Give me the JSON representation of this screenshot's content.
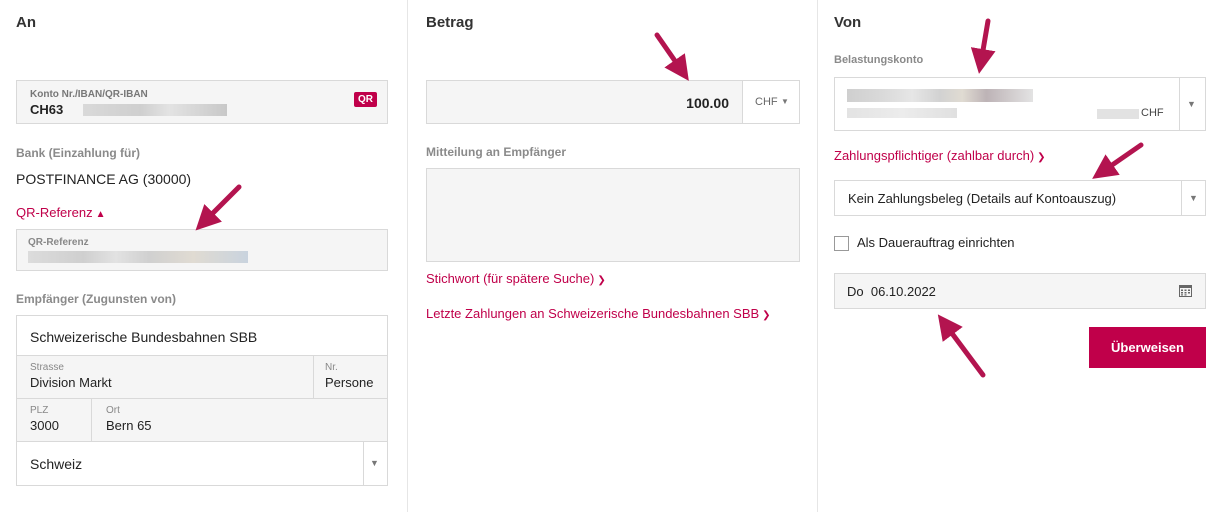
{
  "an": {
    "heading": "An",
    "account_label": "Konto Nr./IBAN/QR-IBAN",
    "account_value": "CH63",
    "qr_badge": "QR",
    "bank_label": "Bank (Einzahlung für)",
    "bank_value": "POSTFINANCE AG (30000)",
    "qr_ref_link": "QR-Referenz",
    "qr_ref_label": "QR-Referenz",
    "recipient_label": "Empfänger (Zugunsten von)",
    "recipient_name": "Schweizerische Bundesbahnen SBB",
    "street_label": "Strasse",
    "street_value": "Division Markt",
    "nr_label": "Nr.",
    "nr_value": "Persone",
    "plz_label": "PLZ",
    "plz_value": "3000",
    "ort_label": "Ort",
    "ort_value": "Bern 65",
    "country_value": "Schweiz"
  },
  "betrag": {
    "heading": "Betrag",
    "amount": "100.00",
    "currency": "CHF",
    "message_label": "Mitteilung an Empfänger",
    "keyword_link": "Stichwort (für spätere Suche)",
    "last_payments_link": "Letzte Zahlungen an Schweizerische Bundesbahnen SBB"
  },
  "von": {
    "heading": "Von",
    "debit_account_label": "Belastungskonto",
    "debit_currency": "CHF",
    "payer_link": "Zahlungspflichtiger (zahlbar durch)",
    "receipt_option": "Kein Zahlungsbeleg (Details auf Kontoauszug)",
    "standing_order_label": "Als Dauerauftrag einrichten",
    "date_value": "Do  06.10.2022",
    "transfer_button": "Überweisen"
  },
  "colors": {
    "accent": "#c0004a",
    "arrow": "#b3144f",
    "border": "#d9d9d9",
    "field_bg": "#f5f5f5"
  },
  "icons": [
    "qr-badge",
    "chevron-up-icon",
    "chevron-down-icon",
    "caret-down-icon",
    "calendar-icon",
    "arrow-annotation"
  ]
}
